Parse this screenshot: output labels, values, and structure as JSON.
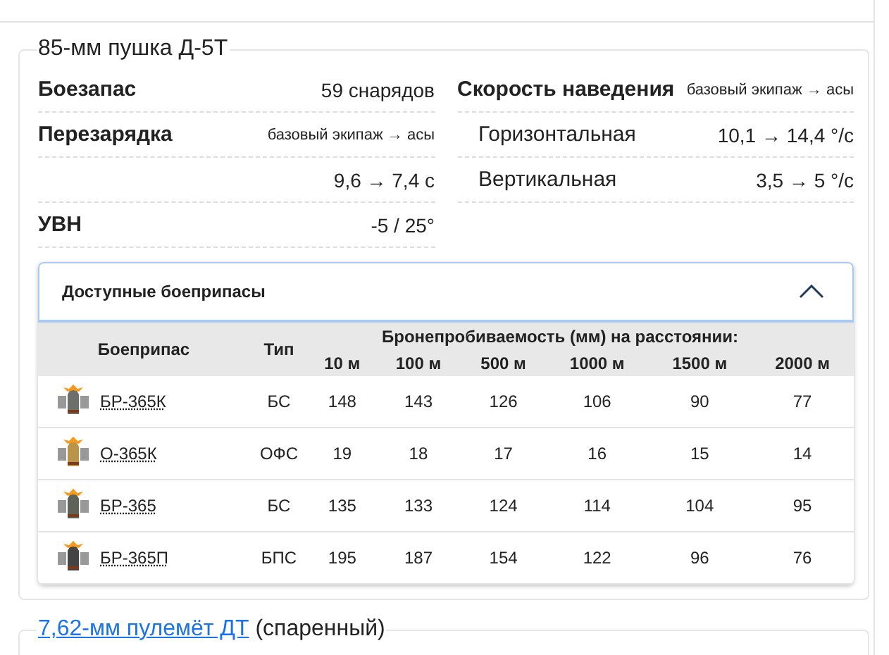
{
  "gun": {
    "title": "85-мм пушка Д-5Т",
    "left_stats": [
      {
        "label": "Боезапас",
        "value": "59 снарядов",
        "kind": "main"
      },
      {
        "label": "Перезарядка",
        "value": "базовый экипаж → асы",
        "kind": "note"
      },
      {
        "value": "9,6 → 7,4 с",
        "kind": "value"
      },
      {
        "label": "УВН",
        "value": "-5 / 25°",
        "kind": "main"
      }
    ],
    "right_stats": [
      {
        "label": "Скорость наведения",
        "value": "базовый экипаж → асы",
        "kind": "note"
      },
      {
        "label": "Горизонтальная",
        "value": "10,1 → 14,4 °/с",
        "kind": "sub"
      },
      {
        "label": "Вертикальная",
        "value": "3,5 → 5 °/с",
        "kind": "sub"
      }
    ],
    "ammo_panel": {
      "title": "Доступные боеприпасы",
      "expanded": true,
      "columns": {
        "name": "Боеприпас",
        "type": "Тип",
        "group": "Бронепробиваемость (мм) на расстоянии:",
        "distances": [
          "10 м",
          "100 м",
          "500 м",
          "1000 м",
          "1500 м",
          "2000 м"
        ]
      },
      "rows": [
        {
          "name": "БР-365К",
          "type": "БС",
          "values": [
            "148",
            "143",
            "126",
            "106",
            "90",
            "77"
          ]
        },
        {
          "name": "О-365К",
          "type": "ОФС",
          "values": [
            "19",
            "18",
            "17",
            "16",
            "15",
            "14"
          ]
        },
        {
          "name": "БР-365",
          "type": "БС",
          "values": [
            "135",
            "133",
            "124",
            "114",
            "104",
            "95"
          ]
        },
        {
          "name": "БР-365П",
          "type": "БПС",
          "values": [
            "195",
            "187",
            "154",
            "122",
            "96",
            "76"
          ]
        }
      ]
    }
  },
  "machine_gun": {
    "link": "7,62-мм пулемёт ДТ",
    "note": "(спаренный)"
  }
}
